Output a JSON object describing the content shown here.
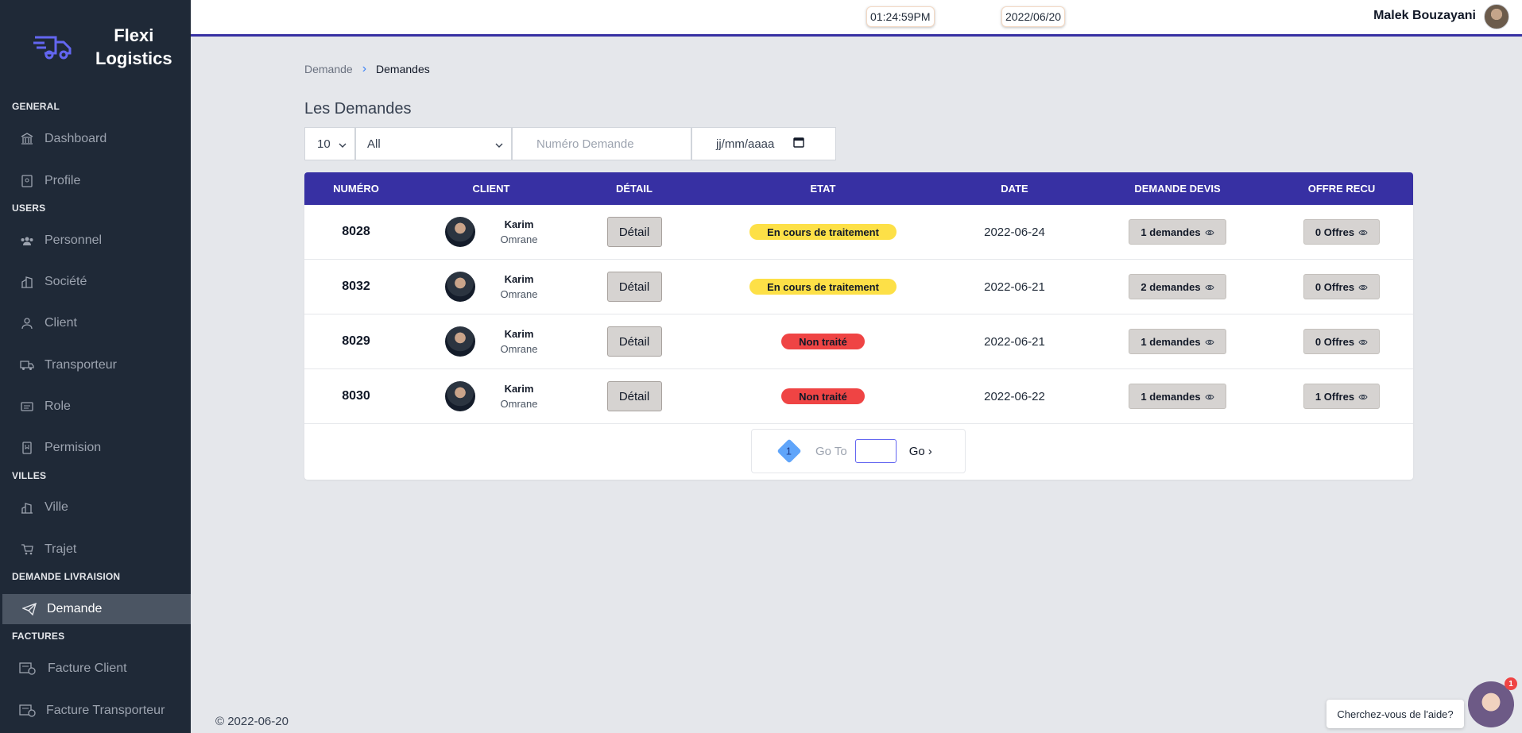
{
  "brand": {
    "line1": "Flexi",
    "line2": "Logistics"
  },
  "topbar": {
    "time": "01:24:59PM",
    "date": "2022/06/20",
    "user_name": "Malek Bouzayani"
  },
  "sidebar": {
    "sections": {
      "general": "GENERAL",
      "users": "USERS",
      "villes": "VILLES",
      "demande_livraison": "DEMANDE LIVRAISION",
      "factures": "FACTURES"
    },
    "items": {
      "dashboard": "Dashboard",
      "profile": "Profile",
      "personnel": "Personnel",
      "societe": "Société",
      "client": "Client",
      "transporteur": "Transporteur",
      "role": "Role",
      "permision": "Permision",
      "ville": "Ville",
      "trajet": "Trajet",
      "demande": "Demande",
      "facture_client": "Facture Client",
      "facture_transporteur": "Facture Transporteur"
    }
  },
  "breadcrumb": {
    "parent": "Demande",
    "current": "Demandes"
  },
  "page_title": "Les Demandes",
  "filters": {
    "page_size": "10",
    "status": "All",
    "number_placeholder": "Numéro Demande",
    "date_placeholder": "jj/mm/aaaa"
  },
  "table": {
    "headers": [
      "NUMÉRO",
      "CLIENT",
      "DÉTAIL",
      "ETAT",
      "DATE",
      "DEMANDE DEVIS",
      "OFFRE RECU"
    ],
    "detail_label": "Détail",
    "rows": [
      {
        "numero": "8028",
        "client_first": "Karim",
        "client_last": "Omrane",
        "etat": "En cours de traitement",
        "etat_type": "warn",
        "date": "2022-06-24",
        "devis": "1 demandes",
        "offres": "0 Offres"
      },
      {
        "numero": "8032",
        "client_first": "Karim",
        "client_last": "Omrane",
        "etat": "En cours de traitement",
        "etat_type": "warn",
        "date": "2022-06-21",
        "devis": "2 demandes",
        "offres": "0 Offres"
      },
      {
        "numero": "8029",
        "client_first": "Karim",
        "client_last": "Omrane",
        "etat": "Non traité",
        "etat_type": "danger",
        "date": "2022-06-21",
        "devis": "1 demandes",
        "offres": "0 Offres"
      },
      {
        "numero": "8030",
        "client_first": "Karim",
        "client_last": "Omrane",
        "etat": "Non traité",
        "etat_type": "danger",
        "date": "2022-06-22",
        "devis": "1 demandes",
        "offres": "1 Offres"
      }
    ]
  },
  "pagination": {
    "current_page": "1",
    "goto_label": "Go To",
    "go_label": "Go"
  },
  "footer": {
    "copyright": "© 2022-06-20"
  },
  "help": {
    "text": "Cherchez-vous de l'aide?",
    "badge": "1"
  },
  "colors": {
    "accent": "#3730a3",
    "sidebar_bg": "#1f2937",
    "warn": "#fde047",
    "danger": "#ef4444"
  }
}
